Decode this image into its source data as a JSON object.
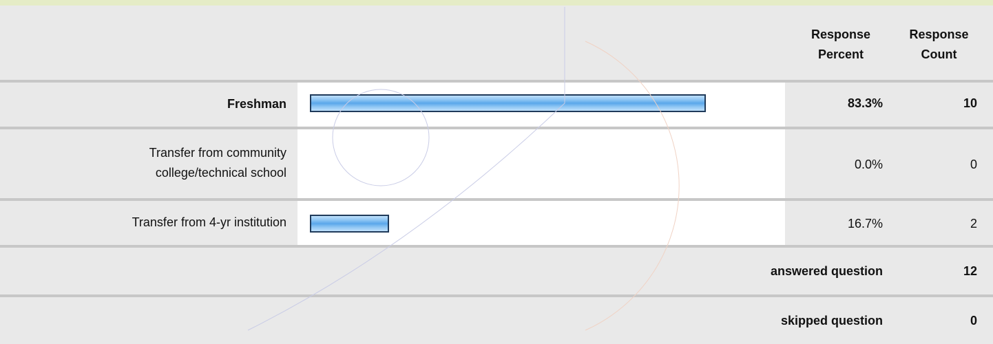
{
  "header": {
    "response_percent": "Response Percent",
    "response_count": "Response Count"
  },
  "chart_data": {
    "type": "bar",
    "categories": [
      "Freshman",
      "Transfer from community college/technical school",
      "Transfer from 4-yr institution"
    ],
    "values": [
      83.3,
      0.0,
      16.7
    ],
    "counts": [
      10,
      0,
      2
    ],
    "percent_labels": [
      "83.3%",
      "0.0%",
      "16.7%"
    ],
    "count_labels": [
      "10",
      "0",
      "2"
    ],
    "highlight": [
      true,
      false,
      false
    ],
    "xlim": [
      0,
      100
    ]
  },
  "rows": [
    {
      "label": "Freshman",
      "percent": "83.3%",
      "count": "10"
    },
    {
      "label_line1": "Transfer from community",
      "label_line2": "college/technical school",
      "percent": "0.0%",
      "count": "0"
    },
    {
      "label": "Transfer from 4-yr institution",
      "percent": "16.7%",
      "count": "2"
    }
  ],
  "summary": {
    "answered_label": "answered question",
    "answered_count": "12",
    "skipped_label": "skipped question",
    "skipped_count": "0"
  },
  "colors": {
    "bar_fill": "#5aa7ea",
    "bar_border": "#1f3a5a",
    "row_gray": "#e9e9e9",
    "top_accent": "#e5ecc6"
  }
}
